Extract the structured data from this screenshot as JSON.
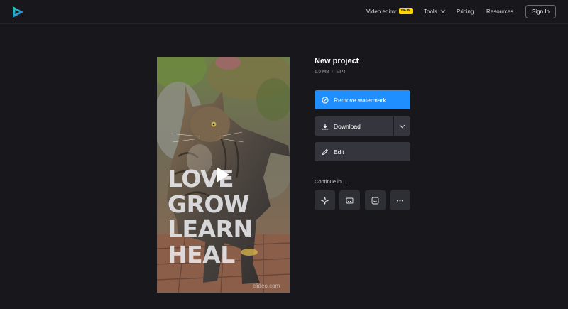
{
  "header": {
    "logo_icon": "play-triangle-logo-icon",
    "nav": [
      {
        "label": "Video editor",
        "badge": "NEW"
      },
      {
        "label": "Tools",
        "icon": "chevron-down-icon"
      },
      {
        "label": "Pricing"
      },
      {
        "label": "Resources"
      }
    ],
    "sign_in_label": "Sign In"
  },
  "video": {
    "overlay_lines": [
      "LOVE",
      "GROW",
      "LEARN",
      "HEAL"
    ],
    "watermark": "clideo.com",
    "play_icon": "play-icon"
  },
  "project": {
    "title": "New project",
    "size": "1.9 MB",
    "separator": "/",
    "format": "MP4"
  },
  "actions": {
    "remove_watermark": {
      "label": "Remove watermark",
      "icon": "no-symbol-icon"
    },
    "download": {
      "label": "Download",
      "icon": "download-icon",
      "menu_icon": "chevron-down-icon"
    },
    "edit": {
      "label": "Edit",
      "icon": "pencil-icon"
    }
  },
  "continue": {
    "label": "Continue in ...",
    "tools": [
      "sparkle-icon",
      "subtitles-icon",
      "sticker-icon",
      "more-icon"
    ]
  },
  "colors": {
    "background": "#17171c",
    "primary": "#1f8fff",
    "button": "#35353d",
    "badge": "#ffd400",
    "logo_gradient": [
      "#2ec4a6",
      "#2f7df6"
    ]
  }
}
